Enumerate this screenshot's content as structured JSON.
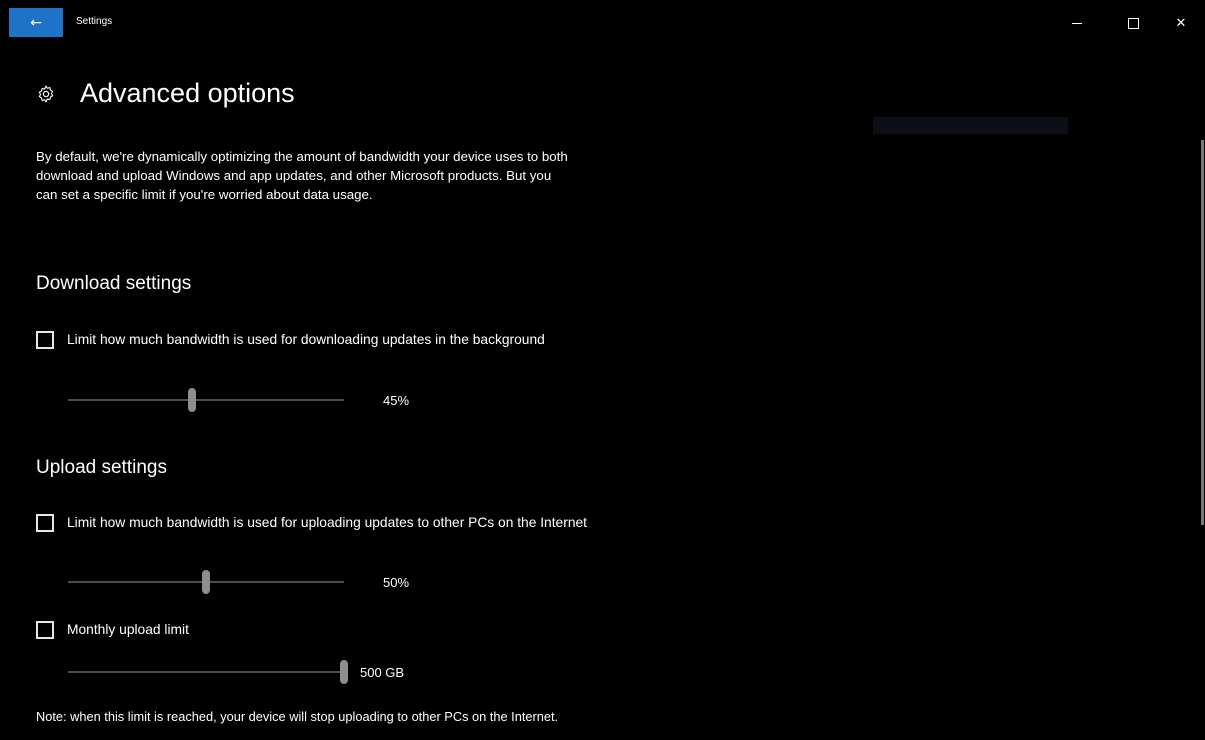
{
  "window": {
    "title": "Settings",
    "back_icon": "arrow-left-icon",
    "controls": [
      "minimize",
      "maximize",
      "close"
    ]
  },
  "page": {
    "title": "Advanced options",
    "icon": "gear-icon",
    "description": "By default, we're dynamically optimizing the amount of bandwidth your device uses to both download and upload Windows and app updates, and other Microsoft products. But you can set a specific limit if you're worried about data usage."
  },
  "download": {
    "section_title": "Download settings",
    "limit_checkbox_label": "Limit how much bandwidth is used for downloading updates in the background",
    "limit_checked": false,
    "slider_value": "45%",
    "slider_percent": 45
  },
  "upload": {
    "section_title": "Upload settings",
    "limit_checkbox_label": "Limit how much bandwidth is used for uploading updates to other PCs on the Internet",
    "limit_checked": false,
    "slider_value": "50%",
    "slider_percent": 50,
    "monthly_checkbox_label": "Monthly upload limit",
    "monthly_checked": false,
    "monthly_value": "500 GB",
    "monthly_fraction": 1.0,
    "note": "Note: when this limit is reached, your device will stop uploading to other PCs on the Internet."
  },
  "colors": {
    "accent": "#1e73c9",
    "background": "#000000",
    "slider_track": "#4d4d4d",
    "slider_thumb": "#8e8e8e"
  }
}
